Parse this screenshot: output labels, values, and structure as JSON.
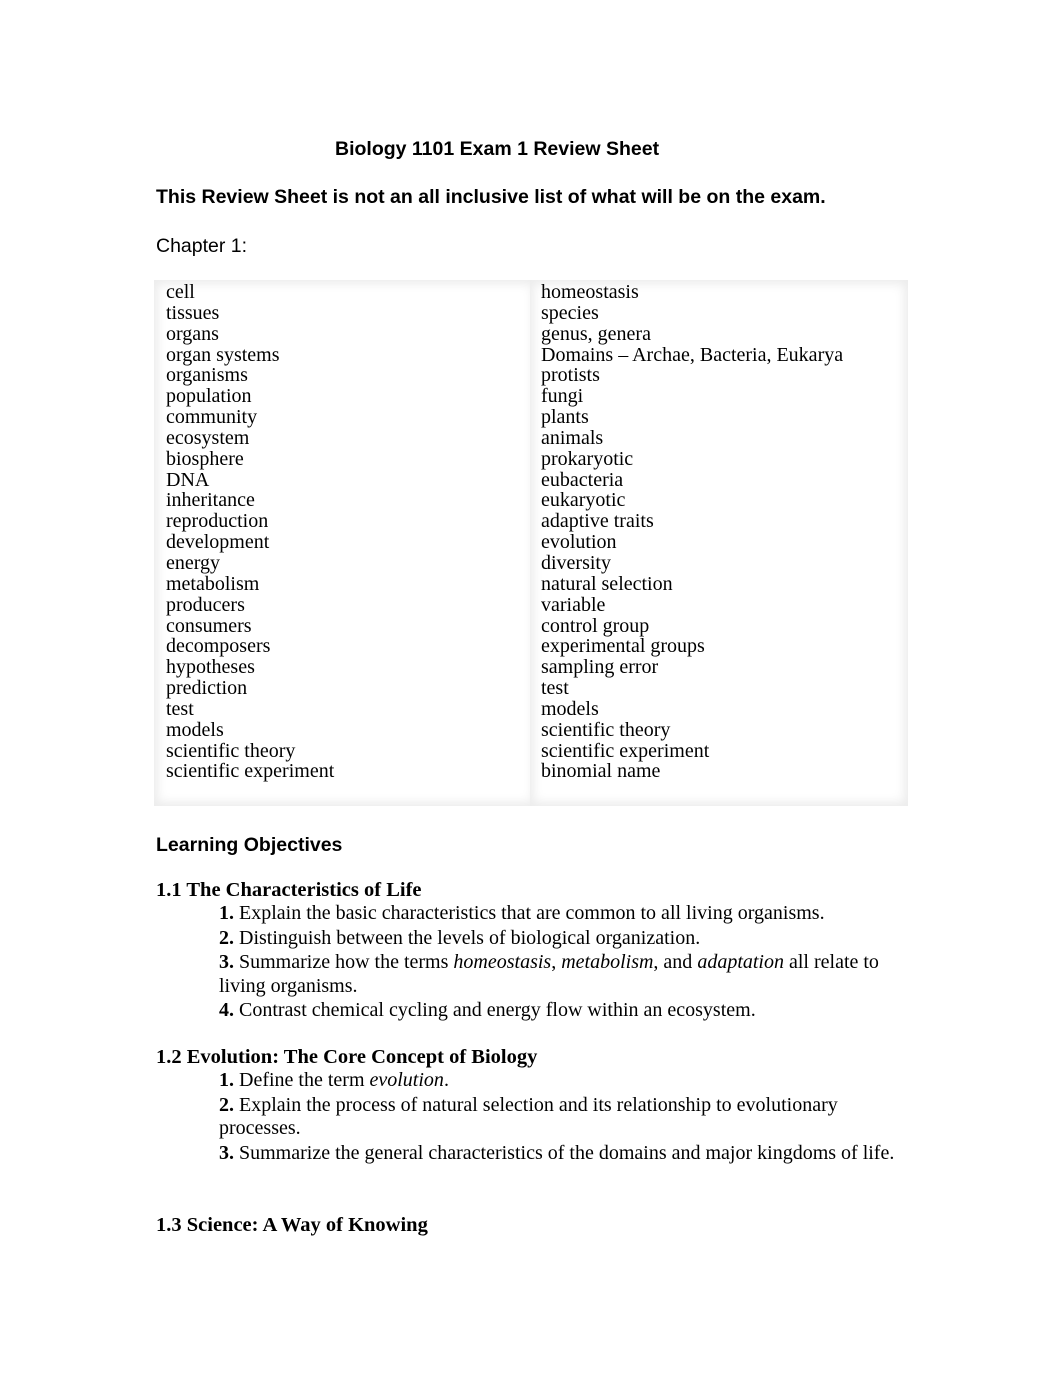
{
  "document": {
    "title": "Biology 1101 Exam 1 Review Sheet",
    "disclaimer": "This Review Sheet is not an all inclusive list of what will be on the exam.",
    "chapter_label": "Chapter 1:",
    "terms": {
      "left": [
        "cell",
        "tissues",
        "organs",
        "organ systems",
        "organisms",
        "population",
        "community",
        "ecosystem",
        "biosphere",
        "DNA",
        "inheritance",
        "reproduction",
        "development",
        "energy",
        "metabolism",
        "producers",
        "consumers",
        "decomposers",
        "hypotheses",
        "prediction",
        "test",
        "models",
        "scientific theory",
        "scientific experiment"
      ],
      "right": [
        "homeostasis",
        "species",
        "genus, genera",
        "Domains – Archae, Bacteria, Eukarya",
        "protists",
        "fungi",
        "plants",
        "animals",
        "prokaryotic",
        "eubacteria",
        "eukaryotic",
        "adaptive traits",
        "evolution",
        "diversity",
        "natural selection",
        "variable",
        "control group",
        "experimental groups",
        "sampling error",
        "test",
        "models",
        "scientific theory",
        "scientific experiment",
        "binomial name"
      ]
    },
    "learning_objectives_heading": "Learning Objectives",
    "sections": [
      {
        "heading": "1.1 The Characteristics of Life",
        "objectives": [
          {
            "num": "1.",
            "parts": [
              {
                "t": " Explain the basic characteristics that are common to all living organisms."
              }
            ]
          },
          {
            "num": "2.",
            "parts": [
              {
                "t": " Distinguish between the levels of biological organization."
              }
            ]
          },
          {
            "num": "3.",
            "parts": [
              {
                "t": " Summarize how the terms "
              },
              {
                "t": "homeostasis",
                "i": true
              },
              {
                "t": ", "
              },
              {
                "t": "metabolism",
                "i": true
              },
              {
                "t": ", and "
              },
              {
                "t": "adaptation",
                "i": true
              },
              {
                "t": " all relate to living organisms."
              }
            ]
          },
          {
            "num": "4.",
            "parts": [
              {
                "t": " Contrast chemical cycling and energy flow within an ecosystem."
              }
            ]
          }
        ]
      },
      {
        "heading": "1.2 Evolution: The Core Concept of Biology",
        "objectives": [
          {
            "num": "1.",
            "parts": [
              {
                "t": " Define the term "
              },
              {
                "t": "evolution",
                "i": true
              },
              {
                "t": "."
              }
            ]
          },
          {
            "num": "2.",
            "parts": [
              {
                "t": " Explain the process of natural selection and its relationship to evolutionary processes."
              }
            ]
          },
          {
            "num": "3.",
            "parts": [
              {
                "t": " Summarize the general characteristics of the domains and major kingdoms of life."
              }
            ]
          }
        ]
      },
      {
        "heading": "1.3 Science: A Way of Knowing",
        "objectives": []
      }
    ]
  }
}
